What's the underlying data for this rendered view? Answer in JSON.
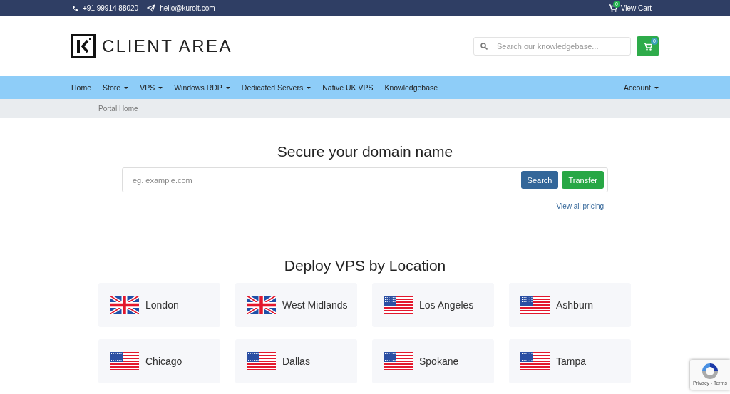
{
  "top_bar": {
    "phone": "+91 99914 88020",
    "email": "hello@kuroit.com",
    "cart_count": "0",
    "cart_label": "View Cart"
  },
  "header": {
    "logo_text": "CLIENT AREA",
    "search": {
      "placeholder": "Search our knowledgebase..."
    },
    "cart_count": "0"
  },
  "nav": {
    "items": [
      {
        "label": "Home",
        "dropdown": false
      },
      {
        "label": "Store",
        "dropdown": true
      },
      {
        "label": "VPS",
        "dropdown": true
      },
      {
        "label": "Windows RDP",
        "dropdown": true
      },
      {
        "label": "Dedicated Servers",
        "dropdown": true
      },
      {
        "label": "Native UK VPS",
        "dropdown": false
      },
      {
        "label": "Knowledgebase",
        "dropdown": false
      }
    ],
    "account": {
      "label": "Account",
      "dropdown": true
    }
  },
  "breadcrumb": "Portal Home",
  "domain": {
    "title": "Secure your domain name",
    "placeholder": "eg. example.com",
    "buttons": [
      {
        "label": "Search",
        "kind": "primary"
      },
      {
        "label": "Transfer",
        "kind": "success"
      }
    ],
    "link": "View all pricing"
  },
  "locations": {
    "title": "Deploy VPS by Location",
    "items": [
      {
        "name": "London",
        "kind": "uk"
      },
      {
        "name": "West Midlands",
        "kind": "uk"
      },
      {
        "name": "Los Angeles",
        "kind": "us"
      },
      {
        "name": "Ashburn",
        "kind": "us"
      },
      {
        "name": "Chicago",
        "kind": "us"
      },
      {
        "name": "Dallas",
        "kind": "us"
      },
      {
        "name": "Spokane",
        "kind": "us"
      },
      {
        "name": "Tampa",
        "kind": "us"
      }
    ]
  },
  "recaptcha": {
    "text": "Privacy - Terms"
  }
}
